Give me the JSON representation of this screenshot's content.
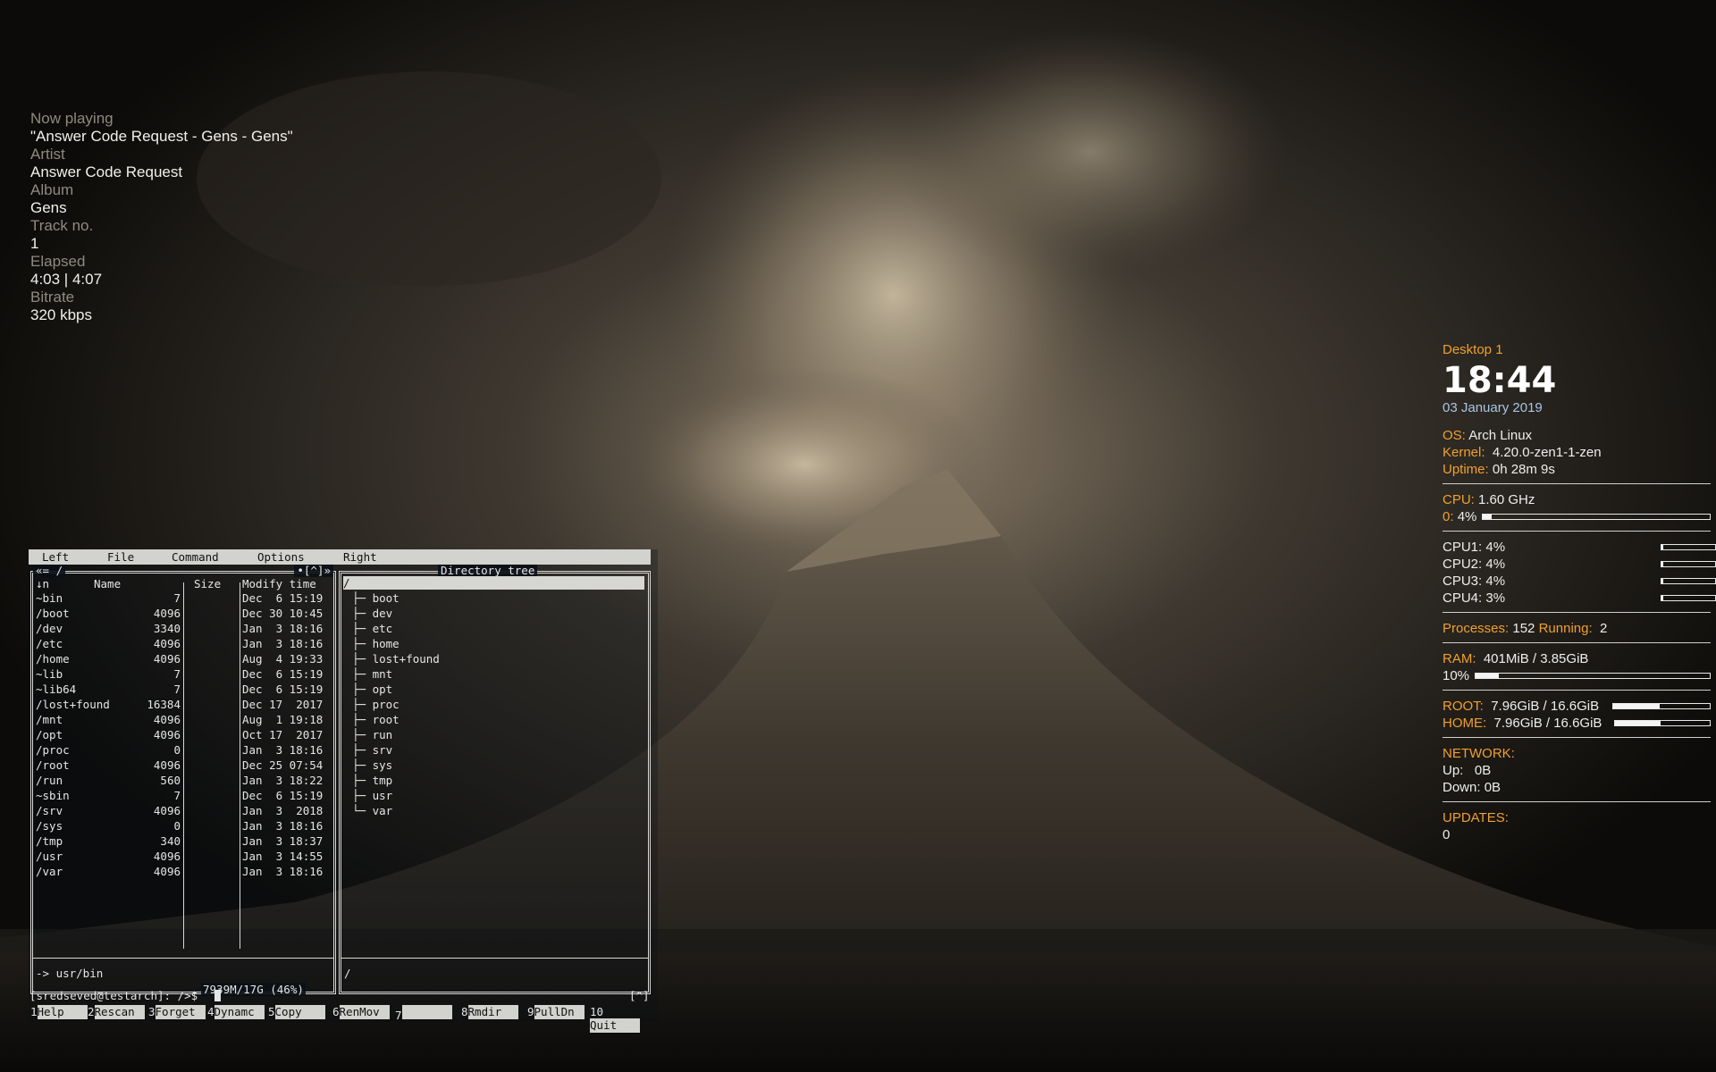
{
  "now_playing": {
    "rows": [
      {
        "label": "Now playing",
        "value": "\"Answer Code Request - Gens - Gens\""
      },
      {
        "label": "Artist",
        "value": "Answer Code Request"
      },
      {
        "label": "Album",
        "value": "Gens"
      },
      {
        "label": "Track no.",
        "value": "1"
      },
      {
        "label": "Elapsed",
        "value": "4:03 | 4:07"
      },
      {
        "label": "Bitrate",
        "value": "320 kbps"
      }
    ]
  },
  "conky": {
    "desktop": "Desktop 1",
    "time": "18:44",
    "date": "03 January 2019",
    "os_label": "OS:",
    "os": "Arch Linux",
    "kernel_label": "Kernel:",
    "kernel": "4.20.0-zen1-1-zen",
    "uptime_label": "Uptime:",
    "uptime": "0h 28m 9s",
    "cpu_label": "CPU:",
    "cpu_freq": "1.60 GHz",
    "cpu0_label": "0:",
    "cpu0": "4%",
    "cpu0_level": 0.04,
    "cores": [
      {
        "label": "CPU1: 4%",
        "level": 0.04
      },
      {
        "label": "CPU2: 4%",
        "level": 0.04
      },
      {
        "label": "CPU3: 4%",
        "level": 0.04
      },
      {
        "label": "CPU4: 3%",
        "level": 0.03
      }
    ],
    "processes_label": "Processes:",
    "processes": "152",
    "running_label": "Running:",
    "running": "2",
    "ram_label": "RAM:",
    "ram": "401MiB / 3.85GiB",
    "ram_pct": "10%",
    "ram_level": 0.1,
    "root_label": "ROOT:",
    "root": "7.96GiB / 16.6GiB",
    "root_level": 0.48,
    "home_label": "HOME:",
    "home": "7.96GiB / 16.6GiB",
    "home_level": 0.48,
    "network_label": "NETWORK:",
    "up_label": "Up:",
    "up": "0B",
    "down_label": "Down:",
    "down": "0B",
    "updates_label": "UPDATES:",
    "updates": "0"
  },
  "mc": {
    "menu": [
      "Left",
      "File",
      "Command",
      "Options",
      "Right"
    ],
    "left_title_left": "«= /",
    "left_title_right": "•[^]»",
    "col_sort": "↓n",
    "col_name": "Name",
    "col_size": "Size",
    "col_mtime": "Modify time",
    "files": [
      {
        "name": "~bin",
        "size": "7",
        "mtime": "Dec  6 15:19"
      },
      {
        "name": "/boot",
        "size": "4096",
        "mtime": "Dec 30 10:45"
      },
      {
        "name": "/dev",
        "size": "3340",
        "mtime": "Jan  3 18:16"
      },
      {
        "name": "/etc",
        "size": "4096",
        "mtime": "Jan  3 18:16"
      },
      {
        "name": "/home",
        "size": "4096",
        "mtime": "Aug  4 19:33"
      },
      {
        "name": "~lib",
        "size": "7",
        "mtime": "Dec  6 15:19"
      },
      {
        "name": "~lib64",
        "size": "7",
        "mtime": "Dec  6 15:19"
      },
      {
        "name": "/lost+found",
        "size": "16384",
        "mtime": "Dec 17  2017"
      },
      {
        "name": "/mnt",
        "size": "4096",
        "mtime": "Aug  1 19:18"
      },
      {
        "name": "/opt",
        "size": "4096",
        "mtime": "Oct 17  2017"
      },
      {
        "name": "/proc",
        "size": "0",
        "mtime": "Jan  3 18:16"
      },
      {
        "name": "/root",
        "size": "4096",
        "mtime": "Dec 25 07:54"
      },
      {
        "name": "/run",
        "size": "560",
        "mtime": "Jan  3 18:22"
      },
      {
        "name": "~sbin",
        "size": "7",
        "mtime": "Dec  6 15:19"
      },
      {
        "name": "/srv",
        "size": "4096",
        "mtime": "Jan  3  2018"
      },
      {
        "name": "/sys",
        "size": "0",
        "mtime": "Jan  3 18:16"
      },
      {
        "name": "/tmp",
        "size": "340",
        "mtime": "Jan  3 18:37"
      },
      {
        "name": "/usr",
        "size": "4096",
        "mtime": "Jan  3 14:55"
      },
      {
        "name": "/var",
        "size": "4096",
        "mtime": "Jan  3 18:16"
      }
    ],
    "left_status": "-> usr/bin",
    "disk_info": "7939M/17G (46%)",
    "tree_title": "Directory tree",
    "tree_root": "/",
    "tree": [
      "boot",
      "dev",
      "etc",
      "home",
      "lost+found",
      "mnt",
      "opt",
      "proc",
      "root",
      "run",
      "srv",
      "sys",
      "tmp",
      "usr",
      "var"
    ],
    "tree_status": "/",
    "prompt": "[sredseved@testarch]: />$",
    "prompt_right": "[^]",
    "fkeys": [
      {
        "num": "1",
        "label": "Help"
      },
      {
        "num": "2",
        "label": "Rescan"
      },
      {
        "num": "3",
        "label": "Forget"
      },
      {
        "num": "4",
        "label": "Dynamc"
      },
      {
        "num": "5",
        "label": "Copy"
      },
      {
        "num": "6",
        "label": "RenMov"
      },
      {
        "num": "7",
        "label": ""
      },
      {
        "num": "8",
        "label": "Rmdir"
      },
      {
        "num": "9",
        "label": "PullDn"
      },
      {
        "num": "10",
        "label": "Quit"
      }
    ]
  }
}
